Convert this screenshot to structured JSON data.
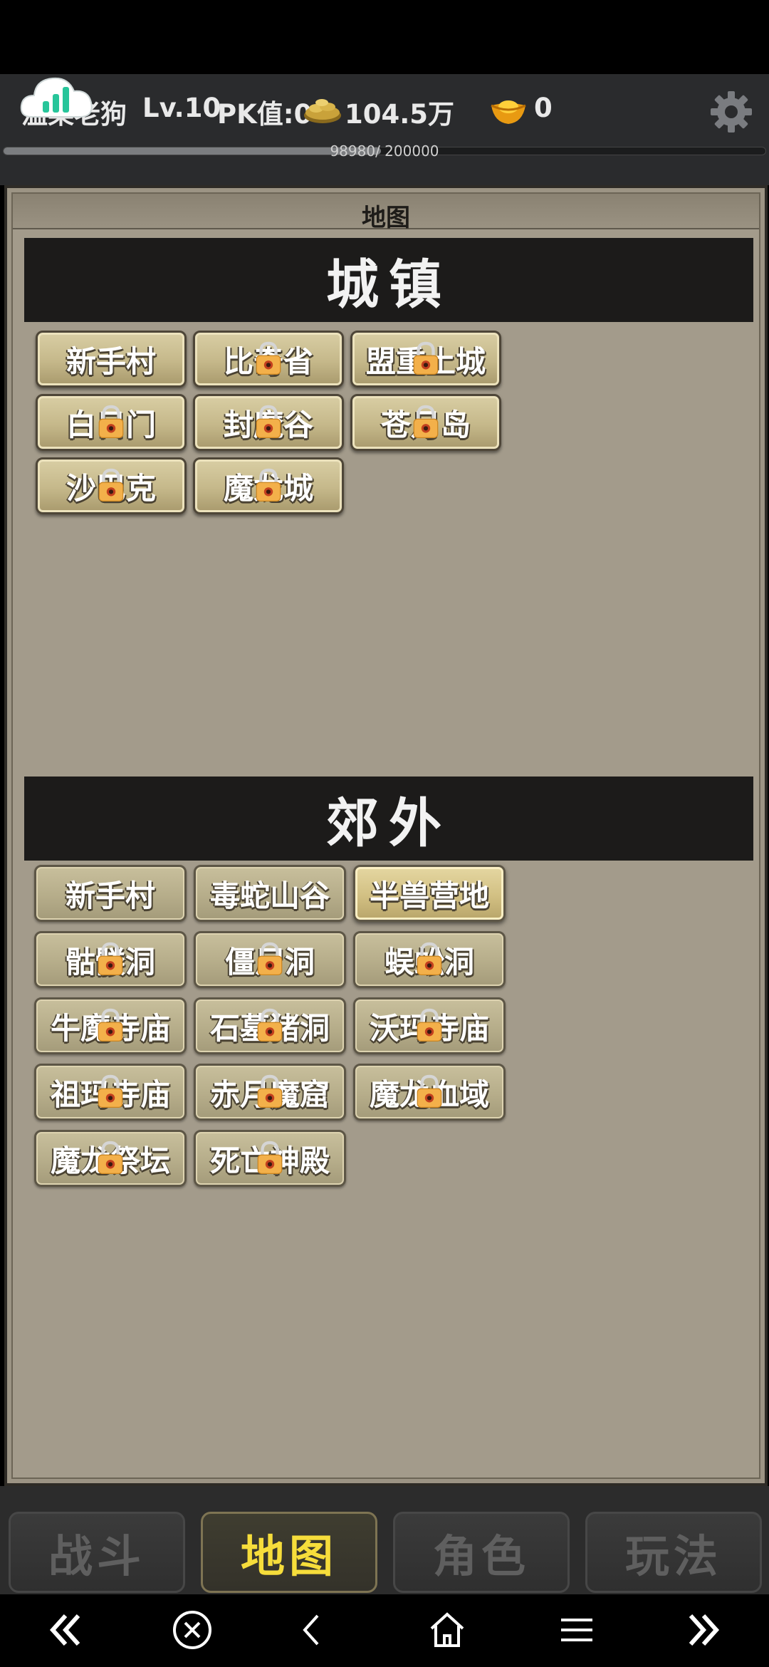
{
  "player": {
    "name": "温柔老狗",
    "level": "Lv.10",
    "pk": "PK值:0",
    "gold": "104.5万",
    "ingots": "0",
    "exp_text": "98980/ 200000",
    "exp_fraction": 0.4949
  },
  "panel": {
    "title": "地图"
  },
  "towns": {
    "title": "城镇",
    "items": [
      {
        "label": "新手村",
        "locked": false
      },
      {
        "label": "比奇省",
        "locked": true
      },
      {
        "label": "盟重土城",
        "locked": true
      },
      {
        "label": "白日门",
        "locked": true
      },
      {
        "label": "封魔谷",
        "locked": true
      },
      {
        "label": "苍月岛",
        "locked": true
      },
      {
        "label": "沙巴克",
        "locked": true
      },
      {
        "label": "魔龙城",
        "locked": true
      }
    ]
  },
  "wild": {
    "title": "郊外",
    "items": [
      {
        "label": "新手村",
        "locked": false
      },
      {
        "label": "毒蛇山谷",
        "locked": false
      },
      {
        "label": "半兽营地",
        "locked": false,
        "active": true
      },
      {
        "label": "骷髅洞",
        "locked": true
      },
      {
        "label": "僵尸洞",
        "locked": true
      },
      {
        "label": "蜈蚣洞",
        "locked": true
      },
      {
        "label": "牛魔寺庙",
        "locked": true
      },
      {
        "label": "石墓猪洞",
        "locked": true
      },
      {
        "label": "沃玛寺庙",
        "locked": true
      },
      {
        "label": "祖玛寺庙",
        "locked": true
      },
      {
        "label": "赤月魔窟",
        "locked": true
      },
      {
        "label": "魔龙血域",
        "locked": true
      },
      {
        "label": "魔龙祭坛",
        "locked": true
      },
      {
        "label": "死亡神殿",
        "locked": true
      }
    ]
  },
  "tabs": [
    {
      "label": "战斗",
      "active": false
    },
    {
      "label": "地图",
      "active": true
    },
    {
      "label": "角色",
      "active": false
    },
    {
      "label": "玩法",
      "active": false
    }
  ],
  "icons": {
    "gold": "gold-coins-icon",
    "ingot": "gold-ingot-icon",
    "settings": "gear-icon",
    "cloud": "cloud-signal-icon",
    "lock": "padlock-icon"
  },
  "colors": {
    "active_tab_text": "#f6dd3b",
    "inactive_tab_text": "#5f5f5f",
    "button_face": "#c5b88a",
    "panel_bg": "#a39b8b"
  }
}
